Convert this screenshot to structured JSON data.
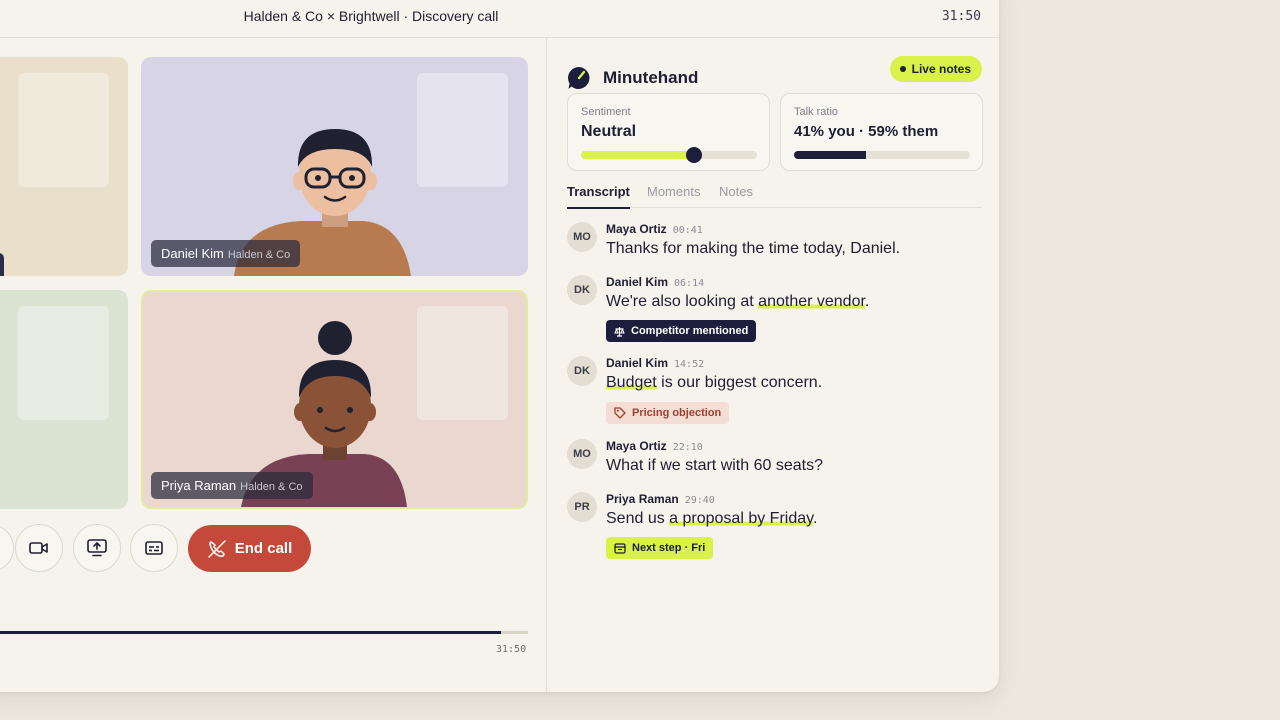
{
  "window": {
    "title": "Halden & Co × Brightwell · Discovery call",
    "timer": "31:50"
  },
  "participants": [
    {
      "name": "Daniel Kim",
      "org": "Halden & Co"
    },
    {
      "name": "Priya Raman",
      "org": "Halden & Co"
    }
  ],
  "controls": {
    "end_call_label": "End call"
  },
  "playback": {
    "time": "31:50",
    "progress_fraction": 0.95
  },
  "sidebar": {
    "brand": "Minutehand",
    "live_badge": "Live notes",
    "sentiment": {
      "label": "Sentiment",
      "value": "Neutral",
      "level_fraction": 0.64
    },
    "talk_ratio": {
      "label": "Talk ratio",
      "value": "41% you · 59% them",
      "you_fraction": 0.41
    },
    "tabs": [
      "Transcript",
      "Moments",
      "Notes"
    ],
    "active_tab": "Transcript",
    "transcript": [
      {
        "initials": "MO",
        "speaker": "Maya Ortiz",
        "time": "00:41",
        "pre": "Thanks for making the time today, Daniel.",
        "hl": "",
        "post": ""
      },
      {
        "initials": "DK",
        "speaker": "Daniel Kim",
        "time": "06:14",
        "pre": "We're also looking at ",
        "hl": "another vendor",
        "post": ".",
        "tag": "Competitor mentioned"
      },
      {
        "initials": "DK",
        "speaker": "Daniel Kim",
        "time": "14:52",
        "pre": "",
        "hl": "Budget",
        "post": " is our biggest concern.",
        "tag": "Pricing objection"
      },
      {
        "initials": "MO",
        "speaker": "Maya Ortiz",
        "time": "22:10",
        "pre": "What if we start with 60 seats?",
        "hl": "",
        "post": ""
      },
      {
        "initials": "PR",
        "speaker": "Priya Raman",
        "time": "29:40",
        "pre": "Send us ",
        "hl": "a proposal by Friday",
        "post": ".",
        "tag": "Next step · Fri"
      }
    ]
  },
  "colors": {
    "accent_lime": "#d8f24a",
    "navy": "#1c1e3b",
    "end_call_red": "#c4493a",
    "pricing_tag_bg": "#f3ddd5"
  }
}
